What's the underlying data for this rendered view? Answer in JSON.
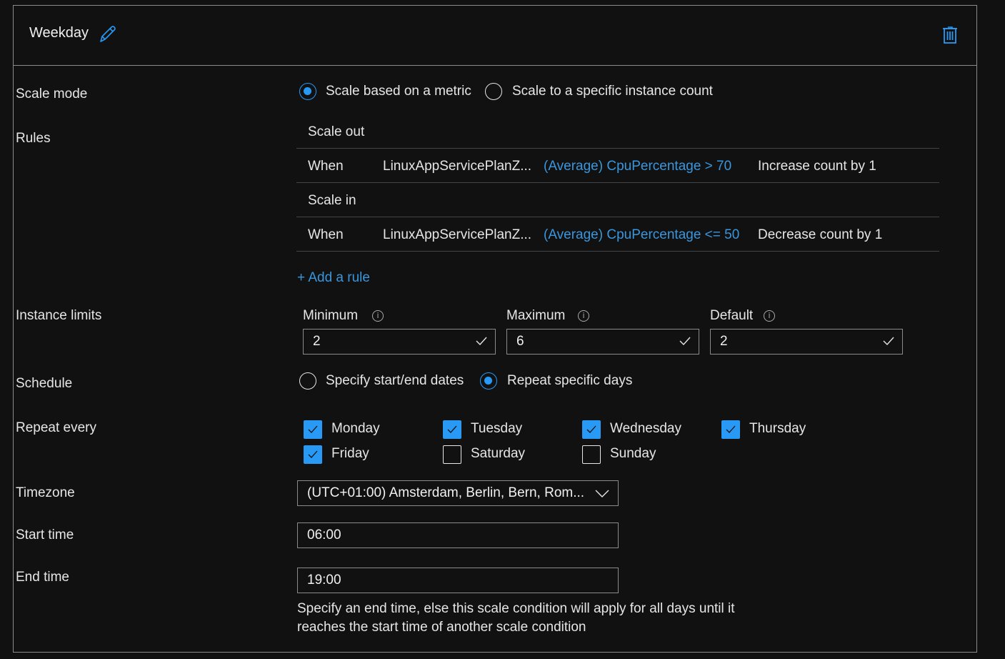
{
  "header": {
    "title": "Weekday",
    "edit_icon": "pencil-icon",
    "delete_icon": "trash-icon"
  },
  "scale_mode": {
    "label": "Scale mode",
    "options": [
      {
        "label": "Scale based on a metric",
        "selected": true
      },
      {
        "label": "Scale to a specific instance count",
        "selected": false
      }
    ]
  },
  "rules": {
    "label": "Rules",
    "scale_out": {
      "heading": "Scale out",
      "when": "When",
      "resource": "LinuxAppServicePlanZ...",
      "condition": "(Average) CpuPercentage > 70",
      "action": "Increase count by 1"
    },
    "scale_in": {
      "heading": "Scale in",
      "when": "When",
      "resource": "LinuxAppServicePlanZ...",
      "condition": "(Average) CpuPercentage <= 50",
      "action": "Decrease count by 1"
    },
    "add_rule": "+ Add a rule"
  },
  "instance_limits": {
    "label": "Instance limits",
    "minimum": {
      "label": "Minimum",
      "value": "2"
    },
    "maximum": {
      "label": "Maximum",
      "value": "6"
    },
    "default": {
      "label": "Default",
      "value": "2"
    }
  },
  "schedule": {
    "label": "Schedule",
    "options": [
      {
        "label": "Specify start/end dates",
        "selected": false
      },
      {
        "label": "Repeat specific days",
        "selected": true
      }
    ]
  },
  "repeat_every": {
    "label": "Repeat every",
    "days": [
      {
        "label": "Monday",
        "checked": true
      },
      {
        "label": "Tuesday",
        "checked": true
      },
      {
        "label": "Wednesday",
        "checked": true
      },
      {
        "label": "Thursday",
        "checked": true
      },
      {
        "label": "Friday",
        "checked": true
      },
      {
        "label": "Saturday",
        "checked": false
      },
      {
        "label": "Sunday",
        "checked": false
      }
    ]
  },
  "timezone": {
    "label": "Timezone",
    "value": "(UTC+01:00) Amsterdam, Berlin, Bern, Rom..."
  },
  "start_time": {
    "label": "Start time",
    "value": "06:00"
  },
  "end_time": {
    "label": "End time",
    "value": "19:00",
    "hint_line1": "Specify an end time, else this scale condition will apply for all days until it",
    "hint_line2": "reaches the start time of another scale condition"
  },
  "colors": {
    "accent": "#2899f5",
    "link": "#3a96dd",
    "background": "#111111",
    "border": "#8a8a8a"
  }
}
